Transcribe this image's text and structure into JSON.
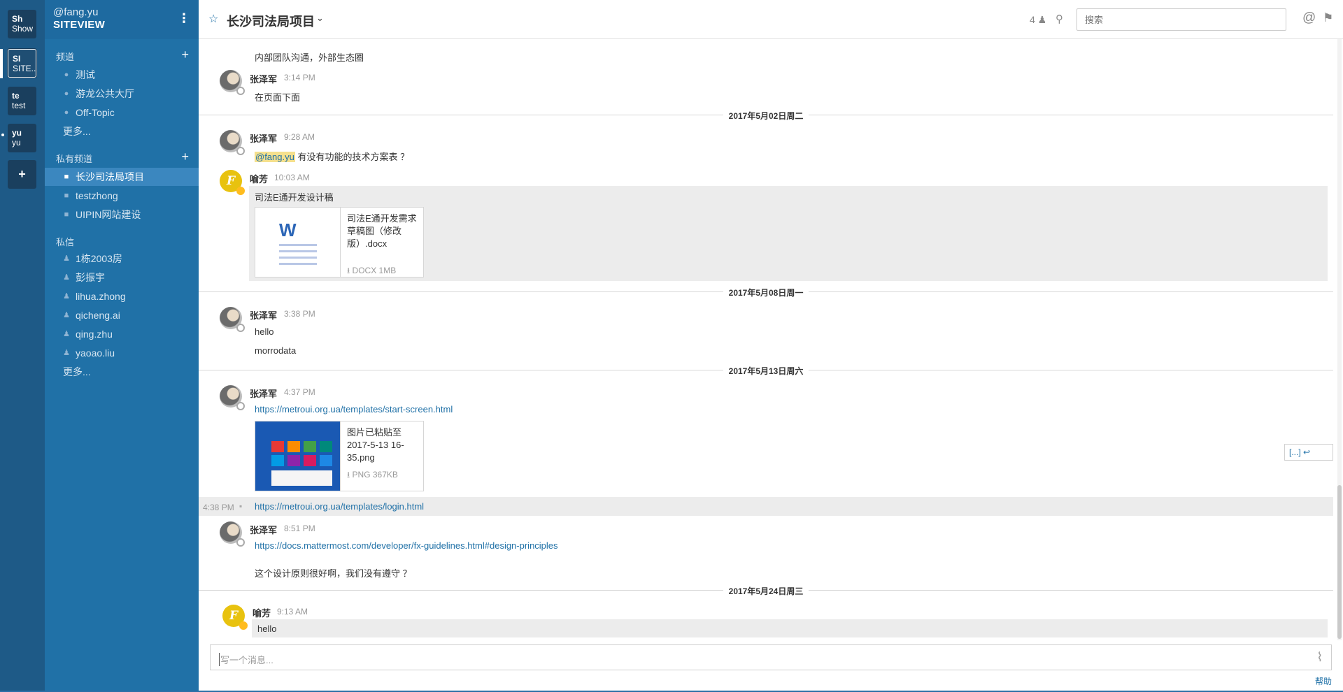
{
  "teams": [
    {
      "abbr": "Sh",
      "name": "Show"
    },
    {
      "abbr": "SI",
      "name": "SITE..."
    },
    {
      "abbr": "te",
      "name": "test"
    },
    {
      "abbr": "yu",
      "name": "yu"
    }
  ],
  "team_add_label": "+",
  "sidebar": {
    "username": "@fang.yu",
    "team_name": "SITEVIEW",
    "menu_icon": "⋮",
    "public_title": "频道",
    "public": [
      "测试",
      "游龙公共大厅",
      "Off-Topic"
    ],
    "public_more": "更多...",
    "private_title": "私有频道",
    "private": [
      "长沙司法局项目",
      "testzhong",
      "UIPIN网站建设"
    ],
    "dm_title": "私信",
    "dms": [
      "1栋2003房",
      "彭振宇",
      "lihua.zhong",
      "qicheng.ai",
      "qing.zhu",
      "yaoao.liu"
    ],
    "dm_more": "更多...",
    "add": "+"
  },
  "header": {
    "channel_name": "长沙司法局项目",
    "member_count": "4",
    "search_placeholder": "搜索",
    "star_icon": "☆",
    "chevron_icon": "⌄",
    "at_icon": "@",
    "icons": [
      "star-icon",
      "chevron-down-icon",
      "member-icon",
      "pin-icon",
      "at-icon",
      "flag-icon"
    ]
  },
  "posts": {
    "p0_text": "内部团队沟通，外部生态圈",
    "p1_user": "张泽军",
    "p1_time": "3:14 PM",
    "p1_text": "在页面下面",
    "sep1": "2017年5月02日周二",
    "p2_user": "张泽军",
    "p2_time": "9:28 AM",
    "p2_mention": "@fang.yu",
    "p2_text": " 有没有功能的技术方案表 ？",
    "p3_user": "喻芳",
    "p3_time": "10:03 AM",
    "p3_avatar": "F",
    "p3_text": "司法E通开发设计稿",
    "file1_name": "司法E通开发需求草稿图（修改版）.docx",
    "file1_meta": "DOCX 1MB",
    "file1_icon": "W",
    "sep2": "2017年5月08日周一",
    "p4_user": "张泽军",
    "p4_time": "3:38 PM",
    "p4_text1": "hello",
    "p4_text2": "morrodata",
    "sep3": "2017年5月13日周六",
    "p5_user": "张泽军",
    "p5_time": "4:37 PM",
    "p5_link": "https://metroui.org.ua/templates/start-screen.html",
    "file2_name": "图片已粘贴至2017-5-13 16-35.png",
    "file2_meta": "PNG 367KB",
    "p6_time": "4:38 PM",
    "p6_link": "https://metroui.org.ua/templates/login.html",
    "hover_menu_more": "[...]",
    "p7_user": "张泽军",
    "p7_time": "8:51 PM",
    "p7_link": "https://docs.mattermost.com/developer/fx-guidelines.html#design-principles",
    "p7_text": "这个设计原则很好啊，我们没有遵守 ？",
    "sep4": "2017年5月24日周三",
    "p8_user": "喻芳",
    "p8_time": "9:13 AM",
    "p8_avatar": "F",
    "p8_text": "hello"
  },
  "composer": {
    "placeholder": "写一个消息..."
  },
  "help": "帮助",
  "colors": {
    "sidebar": "#2071a7",
    "team_rail": "#1e5a87",
    "link": "#2071a7",
    "mention_bg": "#f5e08d",
    "avatar_yellow": "#e8c20f"
  }
}
